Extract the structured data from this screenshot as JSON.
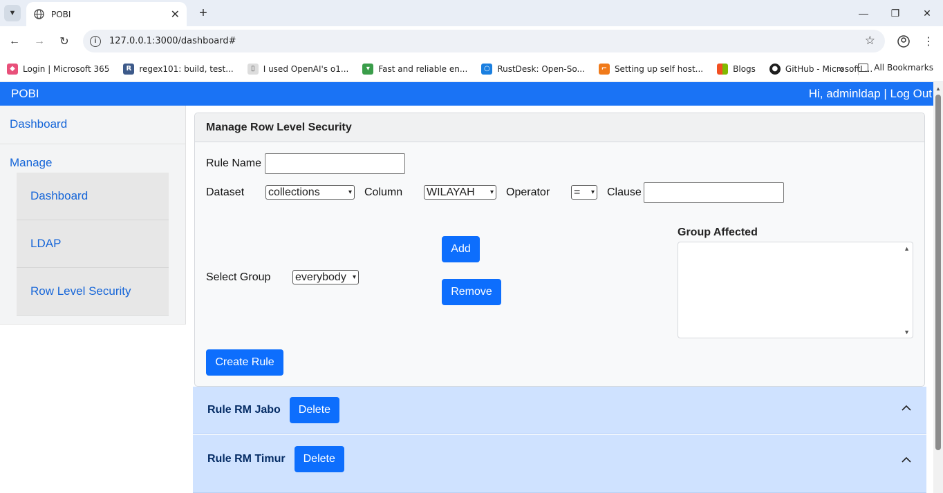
{
  "browser": {
    "tab_title": "POBI",
    "url": "127.0.0.1:3000/dashboard#",
    "bookmarks": [
      {
        "label": "Login | Microsoft 365",
        "icon": "microsoft365-icon",
        "color": "#e8507a"
      },
      {
        "label": "regex101: build, test...",
        "icon": "regex101-icon",
        "color": "#3d5a8a"
      },
      {
        "label": "I used OpenAI's o1...",
        "icon": "page-icon",
        "color": "#999999"
      },
      {
        "label": "Fast and reliable en...",
        "icon": "shield-icon",
        "color": "#3a9d4a"
      },
      {
        "label": "RustDesk: Open-So...",
        "icon": "rustdesk-icon",
        "color": "#1a7fe0"
      },
      {
        "label": "Setting up self host...",
        "icon": "doc-icon",
        "color": "#f07a1a"
      },
      {
        "label": "Blogs",
        "icon": "windows-icon",
        "color": "#f25022"
      },
      {
        "label": "GitHub - MicrosoftL...",
        "icon": "github-icon",
        "color": "#1f1f1f"
      }
    ],
    "all_bookmarks": "All Bookmarks"
  },
  "app": {
    "brand": "POBI",
    "greeting": "Hi, adminldap | Log Out",
    "accent": "#1a73f5"
  },
  "sidebar": {
    "dashboard": "Dashboard",
    "manage": "Manage",
    "items": [
      {
        "label": "Dashboard"
      },
      {
        "label": "LDAP"
      },
      {
        "label": "Row Level Security"
      }
    ]
  },
  "form": {
    "header": "Manage Row Level Security",
    "rule_name_label": "Rule Name",
    "rule_name_value": "",
    "dataset_label": "Dataset",
    "dataset_value": "collections",
    "column_label": "Column",
    "column_value": "WILAYAH",
    "operator_label": "Operator",
    "operator_value": "=",
    "clause_label": "Clause",
    "clause_value": "",
    "select_group_label": "Select Group",
    "select_group_value": "everybody",
    "add_button": "Add",
    "remove_button": "Remove",
    "group_affected_label": "Group Affected",
    "create_button": "Create Rule"
  },
  "rules": [
    {
      "name": "Rule RM Jabo",
      "delete": "Delete"
    },
    {
      "name": "Rule RM Timur",
      "delete": "Delete"
    }
  ]
}
